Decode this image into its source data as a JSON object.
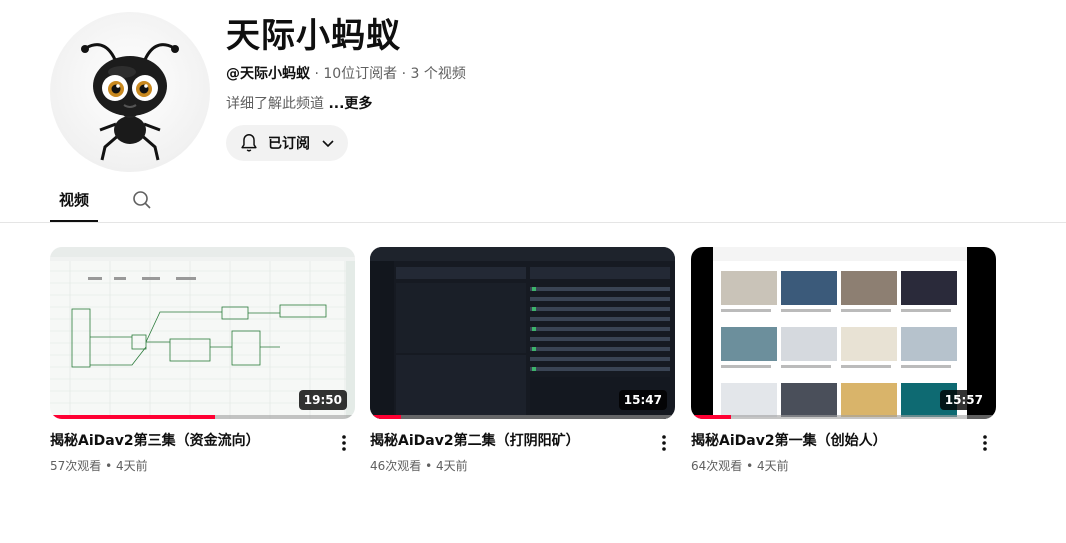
{
  "channel": {
    "name": "天际小蚂蚁",
    "handle": "@天际小蚂蚁",
    "subscribers": "10位订阅者",
    "video_count": "3 个视频",
    "separator": " · ",
    "description": "详细了解此频道 ",
    "more": "...更多",
    "subscribe_label": "已订阅"
  },
  "tabs": {
    "videos": "视频"
  },
  "videos": [
    {
      "title": "揭秘AiDav2第三集（资金流向）",
      "views": "57次观看",
      "age": "4天前",
      "duration": "19:50",
      "watched": 0.54
    },
    {
      "title": "揭秘AiDav2第二集（打阴阳矿）",
      "views": "46次观看",
      "age": "4天前",
      "duration": "15:47",
      "watched": 0.1
    },
    {
      "title": "揭秘AiDav2第一集（创始人）",
      "views": "64次观看",
      "age": "4天前",
      "duration": "15:57",
      "watched": 0.13
    }
  ],
  "stats_separator": " • ",
  "colors": {
    "accent": "#ff0033",
    "text": "#0f0f0f",
    "secondary": "#606060"
  },
  "icons": [
    "ant-mascot",
    "bell-icon",
    "chevron-down-icon",
    "search-icon",
    "more-vert-icon"
  ]
}
